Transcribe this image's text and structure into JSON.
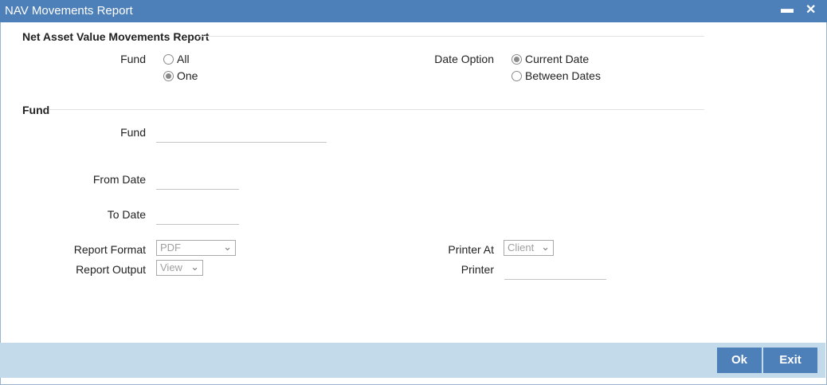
{
  "window": {
    "title": "NAV Movements Report",
    "minimize_glyph": "▬",
    "close_glyph": "✕"
  },
  "section1": {
    "title": "Net Asset Value Movements Report",
    "fund_label": "Fund",
    "fund_options": [
      {
        "label": "All",
        "checked": false
      },
      {
        "label": "One",
        "checked": true
      }
    ],
    "date_option_label": "Date Option",
    "date_options": [
      {
        "label": "Current Date",
        "checked": true
      },
      {
        "label": "Between Dates",
        "checked": false
      }
    ]
  },
  "section2": {
    "title": "Fund",
    "fund_label": "Fund",
    "fund_value": "",
    "from_date_label": "From Date",
    "from_date_value": "",
    "to_date_label": "To Date",
    "to_date_value": ""
  },
  "report": {
    "format_label": "Report Format",
    "format_value": "PDF",
    "output_label": "Report Output",
    "output_value": "View",
    "printer_at_label": "Printer At",
    "printer_at_value": "Client",
    "printer_label": "Printer",
    "printer_value": ""
  },
  "buttons": {
    "ok": "Ok",
    "exit": "Exit"
  },
  "icons": {
    "chevron": "chevron-down-icon",
    "minimize": "minimize-icon",
    "close": "close-icon"
  },
  "colors": {
    "titlebar": "#4d7fb8",
    "footer": "#c3daeb",
    "button": "#4d7fb8"
  }
}
